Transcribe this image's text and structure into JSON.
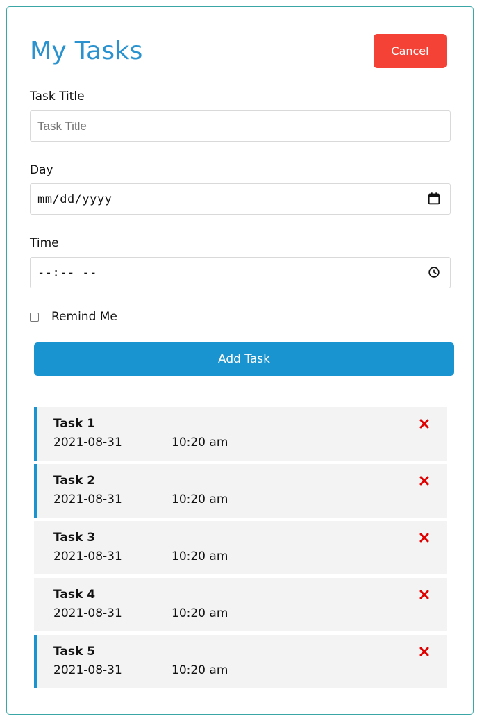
{
  "header": {
    "title": "My Tasks",
    "cancel_label": "Cancel"
  },
  "form": {
    "title_label": "Task Title",
    "title_placeholder": "Task Title",
    "day_label": "Day",
    "day_value": "mm/dd/yyyy",
    "time_label": "Time",
    "time_value": "--:-- --",
    "remind_label": "Remind Me",
    "remind_checked": false,
    "submit_label": "Add Task"
  },
  "tasks": [
    {
      "name": "Task 1",
      "date": "2021-08-31",
      "time": "10:20 am",
      "reminder": true
    },
    {
      "name": "Task 2",
      "date": "2021-08-31",
      "time": "10:20 am",
      "reminder": true
    },
    {
      "name": "Task 3",
      "date": "2021-08-31",
      "time": "10:20 am",
      "reminder": false
    },
    {
      "name": "Task 4",
      "date": "2021-08-31",
      "time": "10:20 am",
      "reminder": false
    },
    {
      "name": "Task 5",
      "date": "2021-08-31",
      "time": "10:20 am",
      "reminder": true
    }
  ],
  "colors": {
    "accent": "#1a94d0",
    "title": "#2a93cf",
    "danger": "#f44336",
    "delete_icon": "#e00000",
    "task_bg": "#f3f3f3"
  },
  "icons": {
    "date_picker": "calendar-icon",
    "time_picker": "clock-icon",
    "delete": "close-icon"
  }
}
